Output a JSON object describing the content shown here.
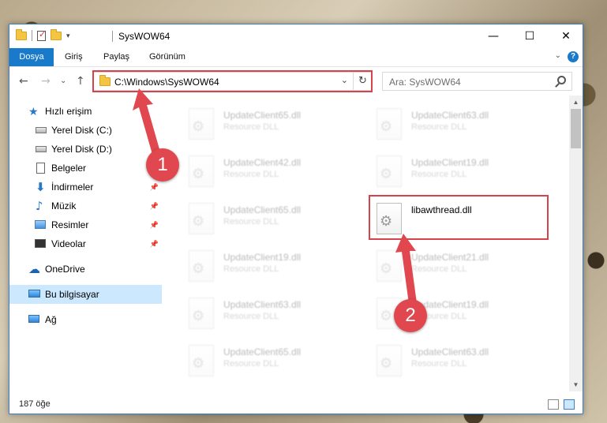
{
  "window": {
    "title": "SysWOW64",
    "minimize_glyph": "—",
    "maximize_glyph": "☐",
    "close_glyph": "✕"
  },
  "ribbon": {
    "tabs": [
      "Dosya",
      "Giriş",
      "Paylaş",
      "Görünüm"
    ],
    "expand_glyph": "⌄",
    "help_glyph": "?"
  },
  "nav_buttons": {
    "back": "←",
    "forward": "→",
    "recent": "⌄",
    "up": "↑"
  },
  "address": {
    "path": "C:\\Windows\\SysWOW64",
    "dropdown_glyph": "⌄",
    "refresh_glyph": "↻"
  },
  "search": {
    "placeholder": "Ara: SysWOW64"
  },
  "sidebar": {
    "items": [
      {
        "label": "Hızlı erişim",
        "icon": "star-icon",
        "pinned": false
      },
      {
        "label": "Yerel Disk (C:)",
        "icon": "drive-icon",
        "pinned": false
      },
      {
        "label": "Yerel Disk (D:)",
        "icon": "drive-icon",
        "pinned": false
      },
      {
        "label": "Belgeler",
        "icon": "documents-icon",
        "pinned": true
      },
      {
        "label": "İndirmeler",
        "icon": "download-icon",
        "pinned": true
      },
      {
        "label": "Müzik",
        "icon": "music-icon",
        "pinned": true
      },
      {
        "label": "Resimler",
        "icon": "pictures-icon",
        "pinned": true
      },
      {
        "label": "Videolar",
        "icon": "videos-icon",
        "pinned": true
      },
      {
        "label": "OneDrive",
        "icon": "onedrive-icon",
        "pinned": false
      },
      {
        "label": "Bu bilgisayar",
        "icon": "this-pc-icon",
        "pinned": false,
        "selected": true
      },
      {
        "label": "Ağ",
        "icon": "network-icon",
        "pinned": false
      }
    ]
  },
  "files": [
    {
      "name": "UpdateClient65.dll",
      "type": "Resource DLL",
      "faded": true
    },
    {
      "name": "UpdateClient63.dll",
      "type": "Resource DLL",
      "faded": true
    },
    {
      "name": "UpdateClient42.dll",
      "type": "Resource DLL",
      "faded": true
    },
    {
      "name": "UpdateClient19.dll",
      "type": "Resource DLL",
      "faded": true
    },
    {
      "name": "UpdateClient65.dll",
      "type": "Resource DLL",
      "faded": true
    },
    {
      "name": "libawthread.dll",
      "type": "",
      "faded": false
    },
    {
      "name": "UpdateClient19.dll",
      "type": "Resource DLL",
      "faded": true
    },
    {
      "name": "UpdateClient21.dll",
      "type": "Resource DLL",
      "faded": true
    },
    {
      "name": "UpdateClient63.dll",
      "type": "Resource DLL",
      "faded": true
    },
    {
      "name": "UpdateClient19.dll",
      "type": "Resource DLL",
      "faded": true
    },
    {
      "name": "UpdateClient65.dll",
      "type": "Resource DLL",
      "faded": true
    },
    {
      "name": "UpdateClient63.dll",
      "type": "Resource DLL",
      "faded": true
    }
  ],
  "status": {
    "item_count": "187 öğe"
  },
  "annotations": {
    "step1": "1",
    "step2": "2",
    "color": "#e0474e"
  }
}
